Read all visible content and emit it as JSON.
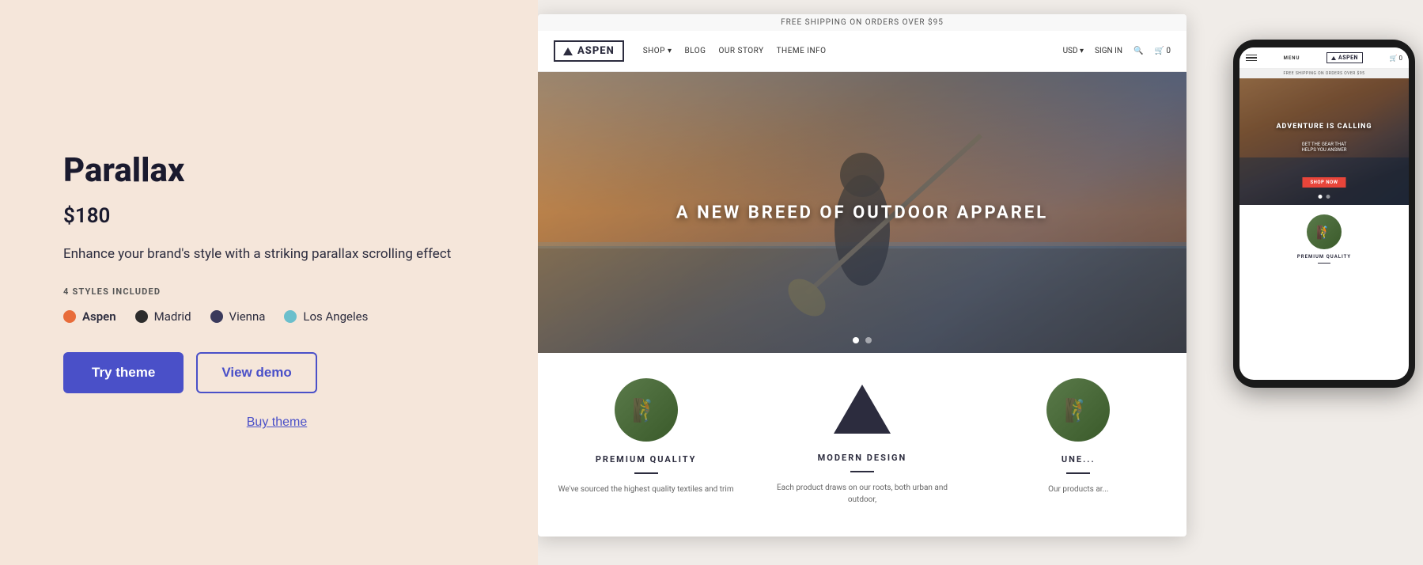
{
  "left": {
    "title": "Parallax",
    "price": "$180",
    "description": "Enhance your brand's style with a striking parallax scrolling effect",
    "styles_label": "4 STYLES INCLUDED",
    "styles": [
      {
        "id": "aspen",
        "name": "Aspen",
        "active": true
      },
      {
        "id": "madrid",
        "name": "Madrid",
        "active": false
      },
      {
        "id": "vienna",
        "name": "Vienna",
        "active": false
      },
      {
        "id": "los-angeles",
        "name": "Los Angeles",
        "active": false
      }
    ],
    "btn_try": "Try theme",
    "btn_demo": "View demo",
    "link_buy": "Buy theme"
  },
  "desktop_preview": {
    "shipping_bar": "FREE SHIPPING ON ORDERS OVER $95",
    "logo": "ASPEN",
    "nav_links": [
      "SHOP ▾",
      "BLOG",
      "OUR STORY",
      "THEME INFO"
    ],
    "nav_right": [
      "USD ▾",
      "SIGN IN",
      "🔍",
      "🛒 0"
    ],
    "hero_text": "A NEW BREED OF OUTDOOR APPAREL",
    "features": [
      {
        "title": "PREMIUM QUALITY",
        "text": "We've sourced the highest quality textiles and trim"
      },
      {
        "title": "MODERN DESIGN",
        "text": "Each product draws on our roots, both urban and outdoor,"
      },
      {
        "title": "UNE...",
        "text": "Our products ar..."
      }
    ]
  },
  "mobile_preview": {
    "logo": "ASPEN",
    "menu_label": "MENU",
    "cart": "🛒 0",
    "shipping": "FREE SHIPPING ON ORDERS OVER $95",
    "hero_text": "ADVENTURE IS CALLING",
    "hero_sub": "GET THE GEAR THAT\nHELPS YOU ANSWER",
    "shop_btn": "SHOP NOW",
    "feature_title": "PREMIUM QUALITY"
  },
  "icons": {
    "triangle": "▲"
  }
}
